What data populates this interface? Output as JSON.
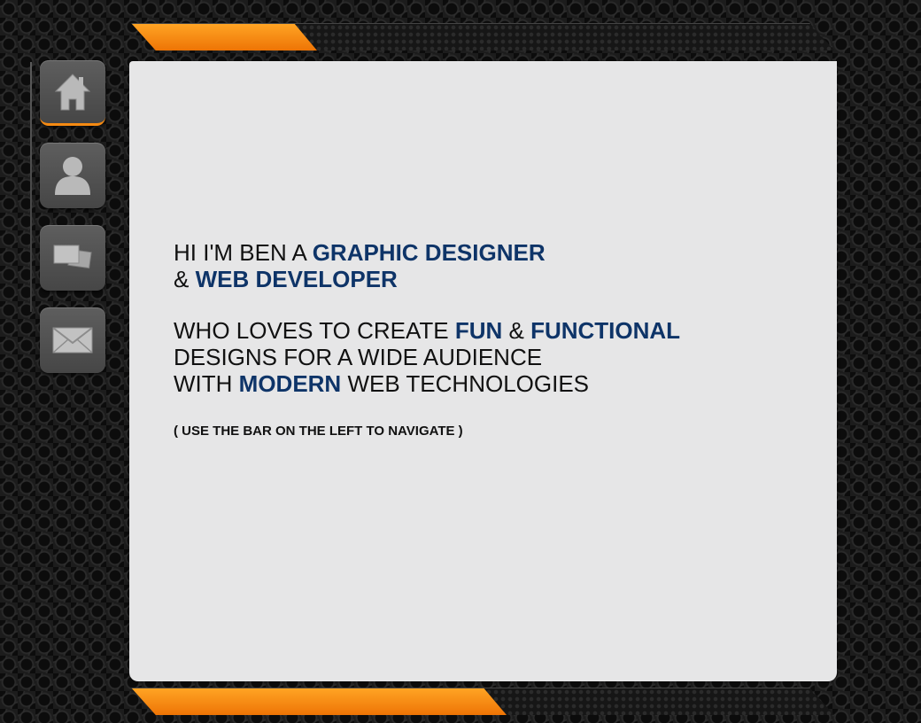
{
  "nav": {
    "items": [
      {
        "icon": "home-icon",
        "active": true
      },
      {
        "icon": "user-icon",
        "active": false
      },
      {
        "icon": "portfolio-icon",
        "active": false
      },
      {
        "icon": "mail-icon",
        "active": false
      }
    ]
  },
  "colors": {
    "accent": "#f58a12",
    "highlight": "#0e3468",
    "panel": "#e6e6e7"
  },
  "intro": {
    "line1_prefix": "HI I'M BEN A ",
    "line1_highlight": "GRAPHIC DESIGNER",
    "line2_prefix": "& ",
    "line2_highlight": "WEB DEVELOPER",
    "line3_prefix": "WHO LOVES TO CREATE ",
    "line3_highlight1": "FUN",
    "line3_mid": " & ",
    "line3_highlight2": "FUNCTIONAL",
    "line4": "DESIGNS FOR A WIDE AUDIENCE",
    "line5_prefix": "WITH ",
    "line5_highlight": "MODERN",
    "line5_suffix": " WEB TECHNOLOGIES",
    "note": "( USE THE BAR ON THE LEFT TO NAVIGATE )"
  }
}
